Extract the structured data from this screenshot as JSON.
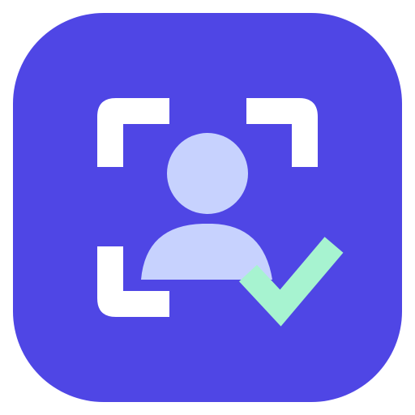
{
  "icon": {
    "name": "face-verification-app-icon",
    "symbols": [
      "scan-frame-icon",
      "user-icon",
      "checkmark-icon"
    ]
  },
  "colors": {
    "background": "#ffffff",
    "tile": "#4f46e5",
    "frame": "#ffffff",
    "user": "#c7d2fe",
    "check": "#a7f3d0"
  }
}
